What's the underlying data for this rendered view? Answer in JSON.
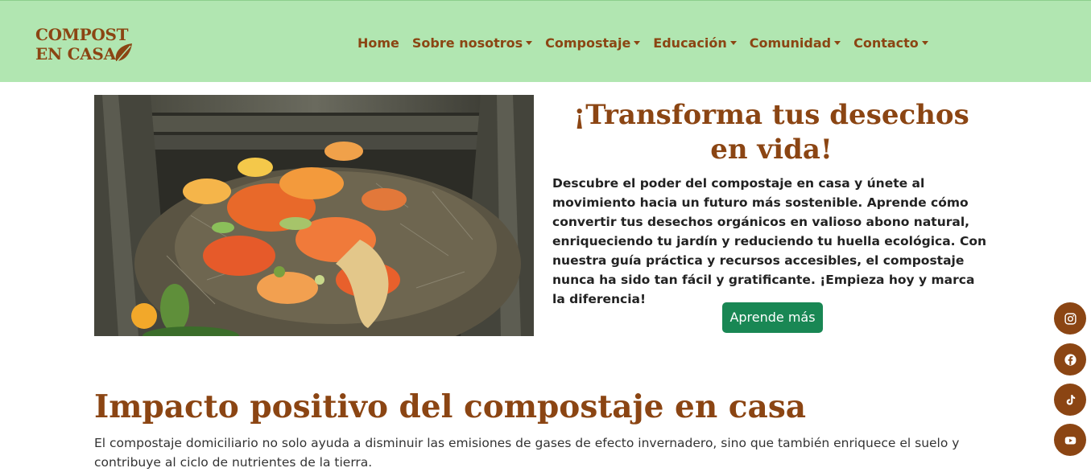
{
  "brand": {
    "line1": "COMPOST",
    "line2": "EN CASA"
  },
  "nav": {
    "items": [
      {
        "label": "Home",
        "dropdown": false
      },
      {
        "label": "Sobre nosotros",
        "dropdown": true
      },
      {
        "label": "Compostaje",
        "dropdown": true
      },
      {
        "label": "Educación",
        "dropdown": true
      },
      {
        "label": "Comunidad",
        "dropdown": true
      },
      {
        "label": "Contacto",
        "dropdown": true
      }
    ]
  },
  "hero": {
    "image_alt": "compost bin with food scraps",
    "title": "¡Transforma tus desechos en vida!",
    "text": "Descubre el poder del compostaje en casa y únete al movimiento hacia un futuro más sostenible. Aprende cómo convertir tus desechos orgánicos en valioso abono natural, enriqueciendo tu jardín y reduciendo tu huella ecológica. Con nuestra guía práctica y recursos accesibles, el compostaje nunca ha sido tan fácil y gratificante. ¡Empieza hoy y marca la diferencia!",
    "cta": "Aprende más"
  },
  "impact": {
    "title": "Impacto positivo del compostaje en casa",
    "text": "El compostaje domiciliario no solo ayuda a disminuir las emisiones de gases de efecto invernadero, sino que también enriquece el suelo y contribuye al ciclo de nutrientes de la tierra."
  },
  "social": [
    {
      "name": "instagram-icon"
    },
    {
      "name": "facebook-icon"
    },
    {
      "name": "tiktok-icon"
    },
    {
      "name": "youtube-icon"
    }
  ],
  "colors": {
    "navbar_bg": "#b1e6b1",
    "brand": "#8b4513",
    "button": "#198754"
  }
}
